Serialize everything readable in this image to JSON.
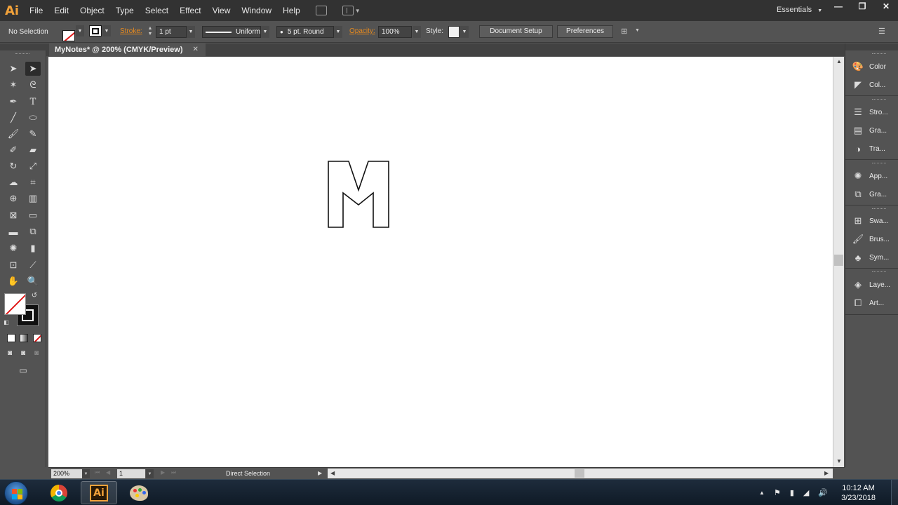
{
  "app": {
    "logo": "Ai"
  },
  "menu": [
    "File",
    "Edit",
    "Object",
    "Type",
    "Select",
    "Effect",
    "View",
    "Window",
    "Help"
  ],
  "workspace": "Essentials",
  "window_controls": {
    "minimize": "—",
    "restore": "❐",
    "close": "✕"
  },
  "control_bar": {
    "selection_status": "No Selection",
    "stroke_label": "Stroke:",
    "stroke_weight": "1 pt",
    "stroke_profile": "Uniform",
    "brush": "5 pt. Round",
    "opacity_label": "Opacity:",
    "opacity": "100%",
    "style_label": "Style:",
    "document_setup": "Document Setup",
    "preferences": "Preferences"
  },
  "document": {
    "tab_title": "MyNotes* @ 200% (CMYK/Preview)",
    "close": "✕"
  },
  "status_bar": {
    "zoom": "200%",
    "page": "1",
    "current_tool": "Direct Selection"
  },
  "panels": [
    {
      "label": "Color",
      "icon": "color-icon"
    },
    {
      "label": "Col...",
      "icon": "color-guide-icon"
    },
    {
      "label": "Stro...",
      "icon": "stroke-icon"
    },
    {
      "label": "Gra...",
      "icon": "gradient-icon"
    },
    {
      "label": "Tra...",
      "icon": "transparency-icon"
    },
    {
      "label": "App...",
      "icon": "appearance-icon"
    },
    {
      "label": "Gra...",
      "icon": "graphic-styles-icon"
    },
    {
      "label": "Swa...",
      "icon": "swatches-icon"
    },
    {
      "label": "Brus...",
      "icon": "brushes-icon"
    },
    {
      "label": "Sym...",
      "icon": "symbols-icon"
    },
    {
      "label": "Laye...",
      "icon": "layers-icon"
    },
    {
      "label": "Art...",
      "icon": "artboards-icon"
    }
  ],
  "taskbar": {
    "apps": [
      "chrome",
      "illustrator",
      "paint"
    ],
    "ai_label": "Ai",
    "time": "10:12 AM",
    "date": "3/23/2018"
  },
  "colors": {
    "accent": "#f2a23a",
    "stroke_orange": "#e68a1f",
    "ui_dark": "#535353"
  }
}
